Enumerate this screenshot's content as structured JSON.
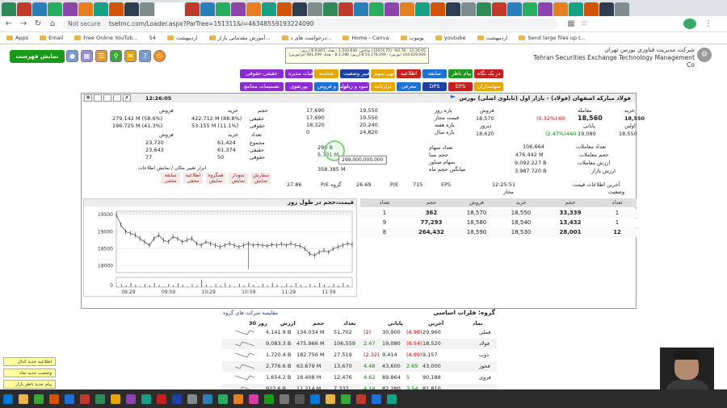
{
  "browser": {
    "url": "tsetmc.com/Loader.aspx?ParTree=151311&i=46348559193224090",
    "security": "Not secure",
    "bookmarks": [
      "Apps",
      "Email",
      "Free Online YouTub...",
      "اردیبهشت",
      "آموزش مقدماتی بازار...",
      "درخواست های د...",
      "Home - Canva",
      "یوتیوب",
      "youtube",
      "اردیبهشت",
      "Send large files up t..."
    ],
    "bookmark_count": "54"
  },
  "site": {
    "show_list": "نمایش فهرست",
    "header_fa": "شرکت مدیریت فناوری بورس تهران",
    "header_en": "Tehran Securities Exchange Technology Management  Co",
    "notice": [
      "12:26:05 - %0.78- (15674.75) شاخص: 1,543,640 - تعداد: 9,841.B ارزش: 164,629,928 (بورس) - 53,178,299 B ارزش: 2,286 B - تعداد: 481,299 (فرابورس)"
    ],
    "menu_row1": [
      {
        "label": "در یک نگاه",
        "color": "#c81e1e"
      },
      {
        "label": "پیام ناظر",
        "color": "#1a9a1a"
      },
      {
        "label": "سابقه",
        "color": "#1e6fd6"
      },
      {
        "label": "اطلاعیه",
        "color": "#c81e1e"
      },
      {
        "label": "آنهی سهم",
        "color": "#e6a800"
      },
      {
        "label": "تغییر وضعیت",
        "color": "#1e3fa6"
      },
      {
        "label": "شناسه",
        "color": "#e6a800"
      },
      {
        "label": "هیات مدیره",
        "color": "#8a2bd6"
      },
      {
        "label": "حقیقی-حقوقی",
        "color": "#8a2bd6"
      }
    ],
    "menu_row2": [
      {
        "label": "سهامداران",
        "color": "#e6a800"
      },
      {
        "label": "EPS",
        "color": "#c81e1e"
      },
      {
        "label": "DPS",
        "color": "#1e3fa6"
      },
      {
        "label": "معرفی",
        "color": "#1e6fd6"
      },
      {
        "label": "ترازنامه",
        "color": "#e6a800"
      },
      {
        "label": "سود و زیان",
        "color": "#8a2bd6"
      },
      {
        "label": "تولید و فروش",
        "color": "#1e6fd6"
      },
      {
        "label": "پورتفوی",
        "color": "#8a2bd6"
      },
      {
        "label": "تصمیمات مجامع",
        "color": "#8a2bd6"
      }
    ],
    "panel": {
      "time": "12:26:05",
      "title": "فولاد مبارکه اصفهان (فولاد) - بازار اول (تابلوی اصلی) بورس",
      "price": {
        "final_label": "پایانی",
        "final": "19,080",
        "final_change": "460",
        "final_pct": "(2.47%)",
        "last_label": "معامله",
        "last": "18,560",
        "last_change": "60",
        "last_pct": "(0.32%)",
        "first_label": "اولین",
        "first": "18,550",
        "prev_label": "دیروز",
        "prev": "18,620",
        "buy_label": "خرید",
        "buy": "18,550",
        "sell_label": "فروش",
        "sell": "18,570",
        "count_label": "تعداد معاملات",
        "count": "106,664",
        "vol_label": "حجم معاملات",
        "vol": "476.442 M",
        "value_label": "ارزش معاملات",
        "value": "9,092.227 B",
        "mcap_label": "ارزش بازار",
        "mcap": "3,987.720 B",
        "updated_label": "آخرین اطلاعات قیمت",
        "updated": "12:25:51",
        "status_label": "وضعیت",
        "status": "مجاز"
      },
      "ranges": [
        {
          "label": "بازه روز",
          "low": "17,690",
          "high": "19,550"
        },
        {
          "label": "قیمت مجاز",
          "low": "17,690",
          "high": "19,550"
        },
        {
          "label": "بازه هفته",
          "low": "18,320",
          "high": "20,240"
        },
        {
          "label": "بازه سال",
          "low": "0",
          "high": "24,820"
        }
      ],
      "share_info": [
        {
          "label": "تعداد سهام",
          "value": "299 B"
        },
        {
          "label": "حجم مبنا",
          "value": "5.731 M"
        },
        {
          "label": "سهام شناور",
          "value": ""
        },
        {
          "label": "میانگین حجم ماه",
          "value": "358.385 M"
        }
      ],
      "tooltip": "299,000,000,000",
      "eps": {
        "eps_label": "EPS",
        "eps": "715",
        "pe_label": "P/E",
        "pe": "26.69",
        "gpe_label": "P/E گروه",
        "gpe": "27.86"
      },
      "note": "* سهام رسیدن به 2 ماه زمان دارد میباشد، (TTM) سود هر سهام بر اساس آخرین",
      "ind": {
        "headers": [
          "حجم",
          "خرید",
          "فروش"
        ],
        "rows": [
          {
            "label": "حقیقی",
            "buy": "422.712 M (88.8%)",
            "sell": "279.142 M (58.6%)"
          },
          {
            "label": "حقوقی",
            "buy": "53.155 M (11.1%)",
            "sell": "196.725 M (41.3%)"
          }
        ],
        "count_header": [
          "تعداد",
          "خرید",
          "فروش"
        ],
        "count_rows": [
          {
            "label": "مجموع",
            "buy": "61,424",
            "sell": "23,720"
          },
          {
            "label": "حقیقی",
            "buy": "61,374",
            "sell": "23,643"
          },
          {
            "label": "حقوقی",
            "buy": "50",
            "sell": "77"
          }
        ]
      },
      "tools_title": "ابزار تغییر مکان / نمایش اطلاعات",
      "tools": [
        "سابقه محفی",
        "اطلاعیه محفی",
        "همگروه نمایش",
        "نمودار نمایش",
        "سفارش نمایش"
      ]
    },
    "chart": {
      "title": "قیمت،حجم در طول روز"
    },
    "chart_data": {
      "type": "line",
      "title": "قیمت،حجم در طول روز",
      "x_ticks": [
        "09:29",
        "09:59",
        "10:29",
        "10:59",
        "11:29",
        "11:59"
      ],
      "y_ticks": [
        "19500",
        "19000",
        "18500",
        "18000"
      ],
      "vol_ticks": [
        "0"
      ],
      "ylim": [
        17800,
        19600
      ],
      "x": [
        0,
        2,
        4,
        6,
        8,
        10,
        12,
        14,
        16,
        18,
        20,
        22,
        24,
        26,
        28,
        30,
        32,
        34,
        36,
        38,
        40,
        42,
        44,
        46,
        48,
        50,
        52,
        54,
        56,
        58,
        60,
        62,
        64,
        66,
        68,
        70,
        72,
        74,
        76,
        78,
        80,
        82,
        84,
        86,
        88,
        90,
        92,
        94,
        96,
        98,
        100
      ],
      "values": [
        19500,
        19200,
        19000,
        18950,
        18900,
        18800,
        18700,
        18600,
        18800,
        18900,
        18750,
        18700,
        18850,
        18800,
        18700,
        18750,
        18800,
        18650,
        18600,
        18700,
        18650,
        18600,
        18550,
        18600,
        18650,
        18600,
        18550,
        18600,
        18650,
        18600,
        18620,
        18600,
        18580,
        18620,
        18600,
        18640,
        18600,
        18650,
        18600,
        18580,
        18500,
        18350,
        18300,
        18400,
        18450,
        18400,
        18500,
        18550,
        18600,
        18650,
        18620
      ]
    },
    "orderbook": {
      "headers": [
        "تعداد",
        "حجم",
        "خرید",
        "فروش",
        "حجم",
        "تعداد"
      ],
      "rows": [
        {
          "bc": "1",
          "bv": "33,339",
          "bp": "18,550",
          "sp": "18,570",
          "sv": "362",
          "sc": "1"
        },
        {
          "bc": "1",
          "bv": "13,432",
          "bp": "18,540",
          "sp": "18,580",
          "sv": "77,293",
          "sc": "9"
        },
        {
          "bc": "12",
          "bv": "28,001",
          "bp": "18,530",
          "sp": "18,590",
          "sv": "264,432",
          "sc": "8"
        }
      ]
    },
    "group": {
      "title": "گروه: فلزات اساسی",
      "compare": "مقایسه شرکت های گروه",
      "headers": [
        "نماد",
        "آخرین",
        "پایانی",
        "تعداد",
        "حجم",
        "ارزش",
        "30 روز"
      ],
      "rows": [
        {
          "sym": "فملی",
          "last": "29,960",
          "lastc": "(4.98)",
          "fin": "30,900",
          "finc": "(2)",
          "cnt": "51,702",
          "vol": "134.034 M",
          "val": "4,141.9 B"
        },
        {
          "sym": "فولاد",
          "last": "18,520",
          "lastc": "(0.54)",
          "fin": "19,080",
          "finc": "2.47",
          "cnt": "106,559",
          "vol": "475.966 M",
          "val": "9,083.3 B"
        },
        {
          "sym": "ذوب",
          "last": "9,157",
          "lastc": "(4.99)",
          "fin": "9,414",
          "finc": "(2.32)",
          "cnt": "27,519",
          "vol": "182.756 M",
          "val": "1,720.4 B"
        },
        {
          "sym": "فخوز",
          "last": "43,000",
          "lastc": "2.65",
          "fin": "43,600",
          "finc": "4.48",
          "cnt": "13,670",
          "vol": "63.679 M",
          "val": "2,776.6 B"
        },
        {
          "sym": "فروی",
          "last": "90,188",
          "lastc": "5",
          "fin": "89,864",
          "finc": "4.62",
          "cnt": "12,476",
          "vol": "18.408 M",
          "val": "1,654.2 B"
        },
        {
          "sym": "...",
          "last": "81,810",
          "lastc": "3.54",
          "fin": "82,280",
          "finc": "4.14",
          "cnt": "7,337",
          "vol": "11.214 M",
          "val": "922.6 B"
        }
      ]
    },
    "side_buttons": [
      "اطلاعیه جدید کدال",
      "وضعیت جدید نماد",
      "پیام جدید ناظر بازار"
    ]
  }
}
